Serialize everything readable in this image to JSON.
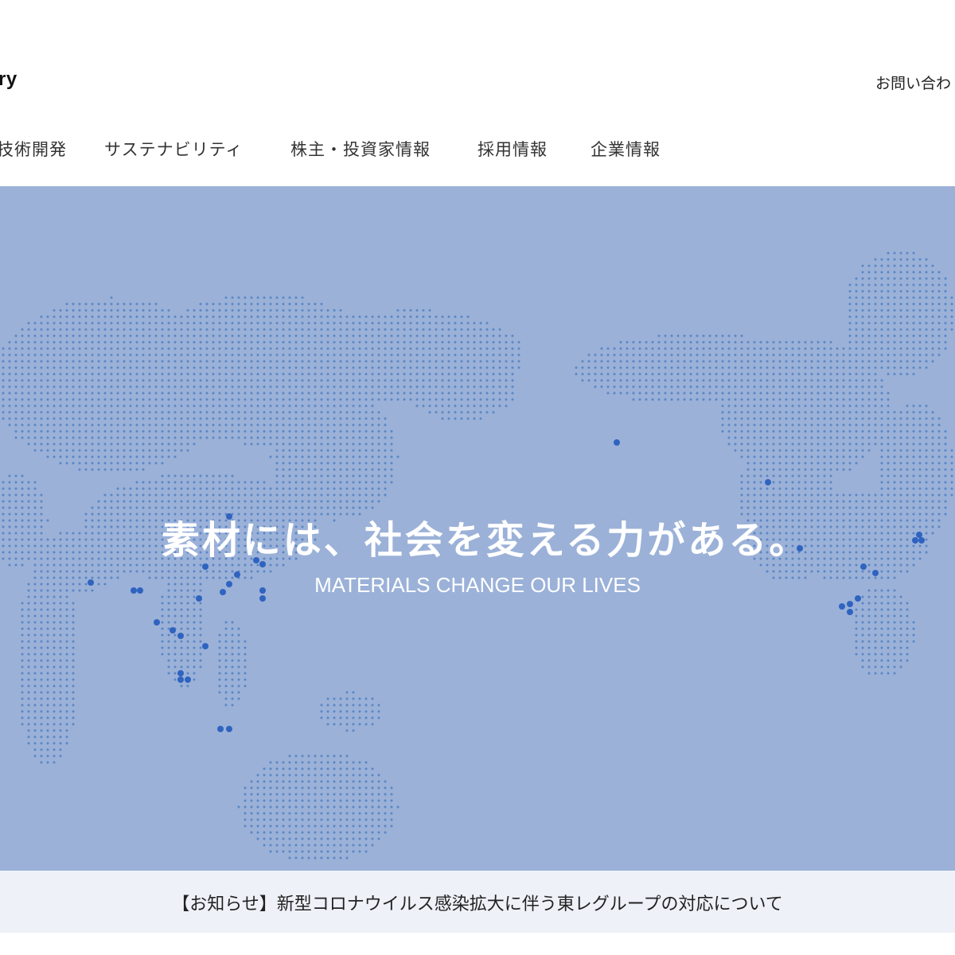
{
  "header": {
    "logo_partial": "ry",
    "contact_label": "お問い合わ"
  },
  "nav": {
    "items": [
      {
        "label": "技術開発"
      },
      {
        "label": "サステナビリティ"
      },
      {
        "label": "株主・投資家情報"
      },
      {
        "label": "採用情報"
      },
      {
        "label": "企業情報"
      }
    ]
  },
  "hero": {
    "title": "素材には、社会を変える力がある。",
    "subtitle": "MATERIALS CHANGE OUR LIVES",
    "background_color": "#9bb1d8",
    "dot_color": "#5b87c4",
    "highlight_color": "#2f63c0"
  },
  "notice": {
    "text": "【お知らせ】新型コロナウイルス感染拡大に伴う東レグループの対応について"
  }
}
